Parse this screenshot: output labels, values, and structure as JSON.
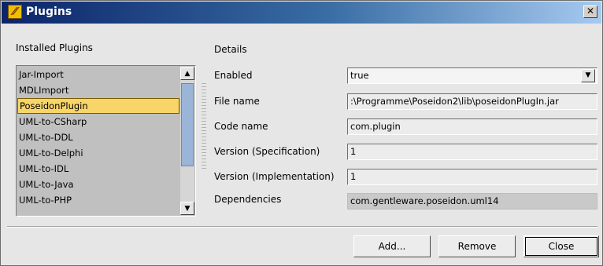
{
  "window": {
    "title": "Plugins"
  },
  "installed": {
    "label": "Installed Plugins",
    "items": [
      "Jar-Import",
      "MDLImport",
      "PoseidonPlugin",
      "UML-to-CSharp",
      "UML-to-DDL",
      "UML-to-Delphi",
      "UML-to-IDL",
      "UML-to-Java",
      "UML-to-PHP"
    ],
    "selected": "PoseidonPlugin"
  },
  "details": {
    "label": "Details",
    "enabled": {
      "label": "Enabled",
      "value": "true"
    },
    "file_name": {
      "label": "File name",
      "value": ":\\Programme\\Poseidon2\\lib\\poseidonPlugIn.jar"
    },
    "code_name": {
      "label": "Code name",
      "value": "com.plugin"
    },
    "version_spec": {
      "label": "Version (Specification)",
      "value": "1"
    },
    "version_impl": {
      "label": "Version (Implementation)",
      "value": "1"
    },
    "dependencies": {
      "label": "Dependencies",
      "value": "com.gentleware.poseidon.uml14"
    }
  },
  "buttons": {
    "add": "Add...",
    "remove": "Remove",
    "close": "Close"
  },
  "colors": {
    "title_start": "#0b246a",
    "title_end": "#a6caf0",
    "selection": "#f8d568"
  }
}
